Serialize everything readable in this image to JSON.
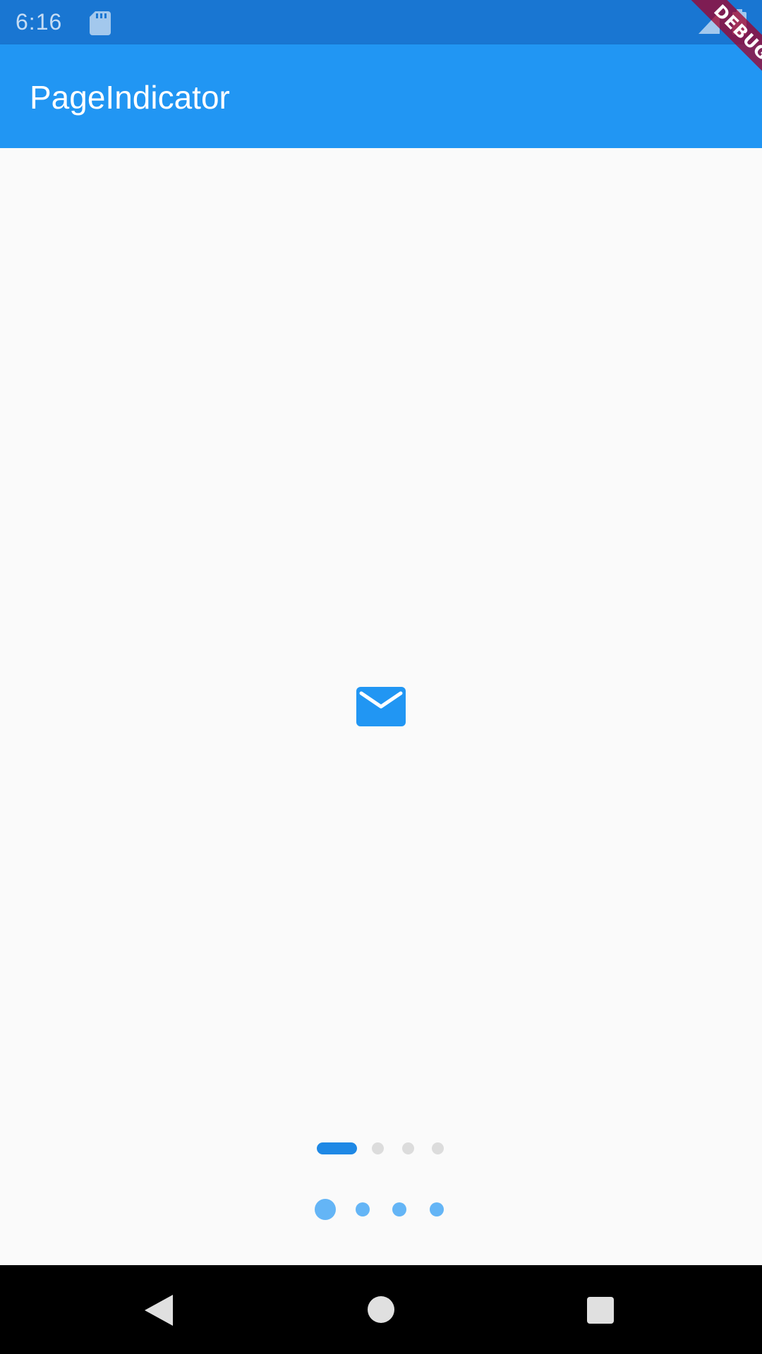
{
  "status_bar": {
    "time": "6:16",
    "icons": [
      "sd-card-icon",
      "signal-icon",
      "battery-icon"
    ]
  },
  "app_bar": {
    "title": "PageIndicator",
    "color": "#2196f3"
  },
  "debug_banner": {
    "label": "DEBUG"
  },
  "content": {
    "center_icon": "mail-icon",
    "indicators": [
      {
        "style": "pill",
        "count": 4,
        "active_index": 0,
        "active_color": "#1e88e5",
        "inactive_color": "#dcdcdc"
      },
      {
        "style": "scale-dot",
        "count": 4,
        "active_index": 0,
        "active_color": "#64b5f6",
        "inactive_color": "#64b5f6"
      }
    ]
  },
  "nav_bar": {
    "buttons": [
      "back-icon",
      "home-icon",
      "recents-icon"
    ]
  }
}
